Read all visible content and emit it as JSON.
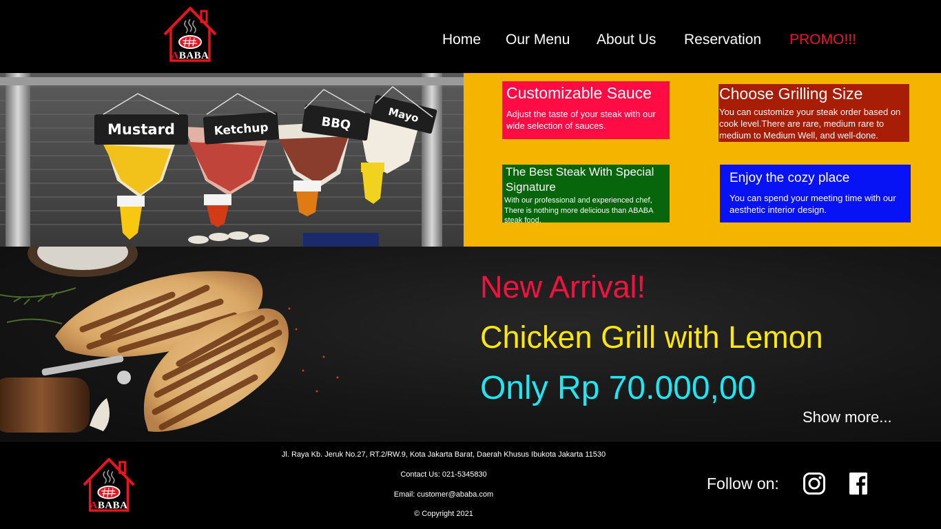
{
  "brand": {
    "logo_first_letter": "A",
    "logo_rest": "BABA",
    "brand_red": "#e8141e"
  },
  "nav": {
    "items": [
      {
        "label": "Home"
      },
      {
        "label": "Our Menu"
      },
      {
        "label": "About Us"
      },
      {
        "label": "Reservation"
      },
      {
        "label": "PROMO!!!"
      }
    ]
  },
  "sauce_photo": {
    "labels": [
      "Mustard",
      "Ketchup",
      "BBQ",
      "Mayo"
    ]
  },
  "features": {
    "panel_color": "#f4b400",
    "sauce": {
      "title": "Customizable Sauce",
      "description": "Adjust the taste of your steak with our wide selection of sauces.",
      "color": "#ff0c45"
    },
    "grilling": {
      "title": "Choose Grilling Size",
      "description": "You can customize your steak order based on cook level.There are rare, medium rare to medium to Medium Well, and well-done.",
      "color": "#a71d05"
    },
    "steak": {
      "title": "The Best Steak With Special Signature",
      "description": "With our professional and experienced chef, There is nothing more delicious than ABABA steak food.",
      "color": "#07660b"
    },
    "cozy": {
      "title": "Enjoy the cozy place",
      "description": "You can spend your meeting time with our aesthetic interior design.",
      "color": "#0713f5"
    }
  },
  "promo": {
    "headline": "New Arrival!",
    "product": "Chicken Grill with Lemon",
    "price": "Only Rp 70.000,00",
    "show_more": "Show more..."
  },
  "footer": {
    "address": "Jl. Raya Kb. Jeruk No.27, RT.2/RW.9, Kota Jakarta Barat, Daerah Khusus Ibukota Jakarta 11530",
    "contact": "Contact Us: 021-5345830",
    "email": "Email: customer@ababa.com",
    "copyright": "© Copyright 2021",
    "follow_label": "Follow on:",
    "social_icons": [
      "instagram-icon",
      "facebook-icon"
    ]
  }
}
